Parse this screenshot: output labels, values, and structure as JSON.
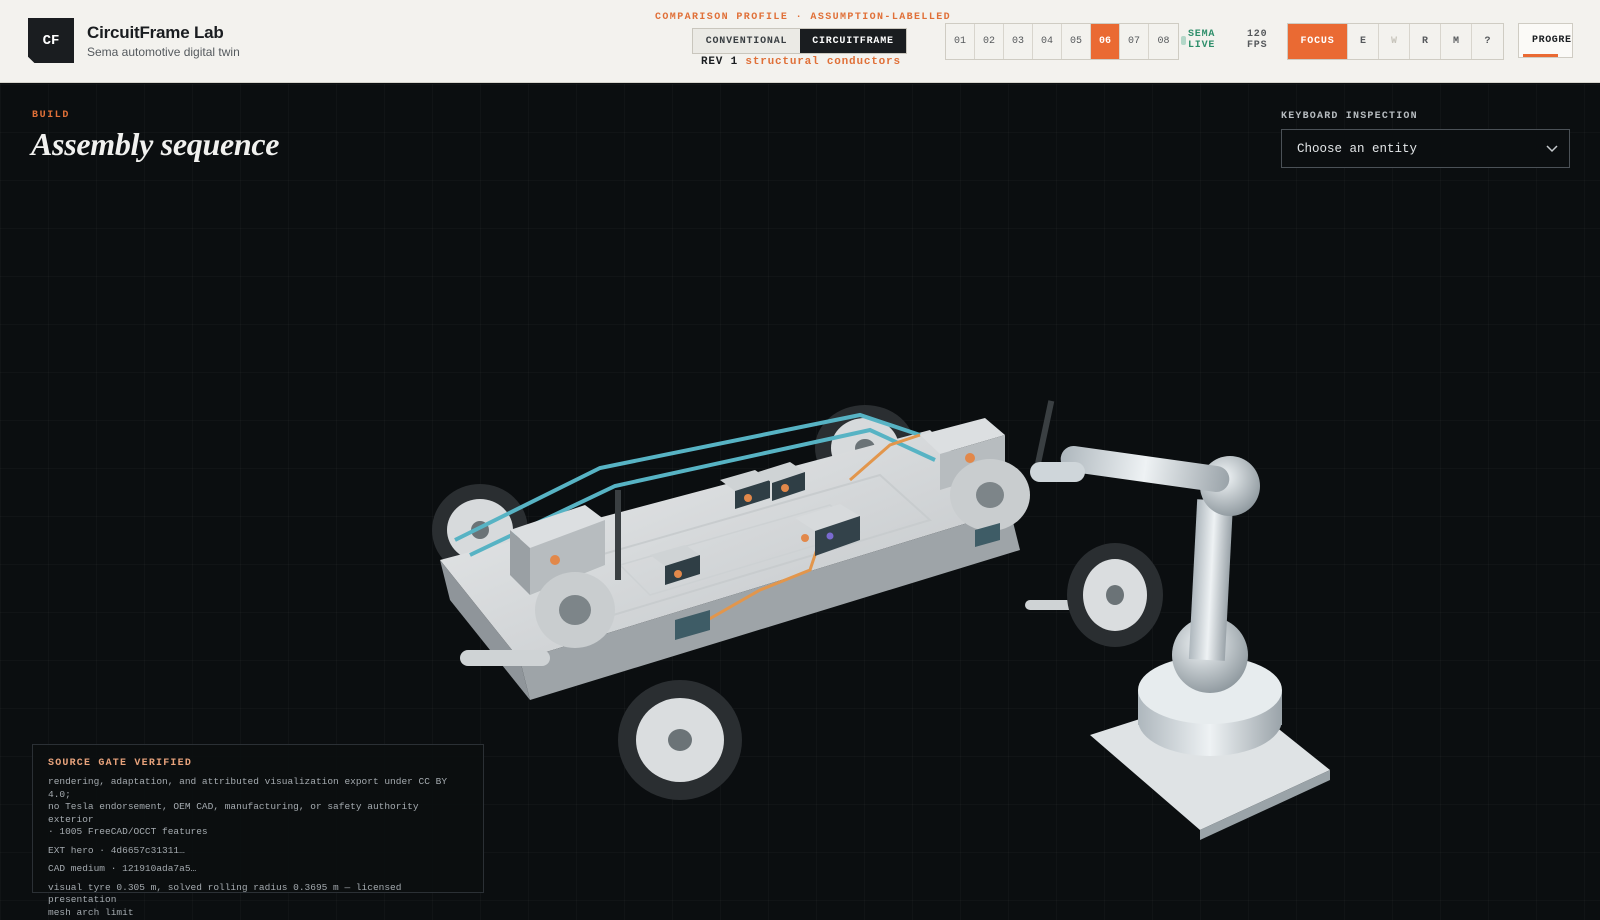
{
  "brand": {
    "logo": "CF",
    "title": "CircuitFrame Lab",
    "subtitle": "Sema automotive digital twin"
  },
  "header": {
    "profile_label": "COMPARISON PROFILE · ASSUMPTION-LABELLED",
    "toggle": {
      "conventional": "CONVENTIONAL",
      "circuitframe": "CIRCUITFRAME",
      "selected": "CIRCUITFRAME"
    },
    "rev_key": "REV 1",
    "rev_value": "structural conductors",
    "steps": [
      "01",
      "02",
      "03",
      "04",
      "05",
      "06",
      "07",
      "08"
    ],
    "active_step": "06",
    "live_line1": "SEMA",
    "live_line2": "LIVE",
    "fps_value": "120",
    "fps_unit": "FPS",
    "tools": {
      "focus": "FOCUS",
      "e": "E",
      "w": "W",
      "r": "R",
      "m": "M",
      "help": "?"
    },
    "progress_label": "PROGRESS",
    "progress_fraction": 0.78,
    "colors": {
      "accent": "#ea6a33",
      "live": "#2f8f6b",
      "ink": "#1a1d20"
    }
  },
  "main": {
    "eyebrow": "BUILD",
    "title": "Assembly sequence",
    "inspection_label": "KEYBOARD INSPECTION",
    "entity_select": {
      "value": "Choose an entity",
      "icon": "chevron-down-icon"
    }
  },
  "source_panel": {
    "title": "SOURCE GATE VERIFIED",
    "line1": "rendering, adaptation, and attributed visualization export under CC BY 4.0;",
    "line2": "no Tesla endorsement, OEM CAD, manufacturing, or safety authority exterior",
    "line3": "· 1005 FreeCAD/OCCT features",
    "ext": "EXT hero · 4d6657c31311…",
    "cad": "CAD medium · 121910ada7a5…",
    "tyre1": "visual tyre 0.305 m, solved rolling radius 0.3695 m — licensed presentation",
    "tyre2": "mesh arch limit"
  }
}
